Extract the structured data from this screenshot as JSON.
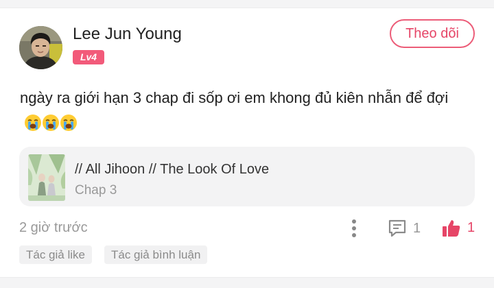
{
  "post": {
    "author": {
      "name": "Lee Jun Young",
      "level": "Lv4",
      "level_color": "#f25a7a"
    },
    "follow_label": "Theo dõi",
    "text": "ngày ra giới hạn 3 chap đi sốp ơi em khong đủ kiên nhẫn để đợi",
    "emojis": [
      "loudly-crying-face-icon",
      "loudly-crying-face-icon",
      "loudly-crying-face-icon"
    ],
    "story": {
      "title": "// All Jihoon // The Look Of Love",
      "chapter": "Chap 3"
    },
    "timestamp": "2 giờ trước",
    "comment_count": "1",
    "like_count": "1",
    "tags": [
      "Tác giả like",
      "Tác giả bình luận"
    ],
    "colors": {
      "accent": "#e64567",
      "muted_text": "#999999",
      "card_bg": "#f3f3f4"
    }
  }
}
